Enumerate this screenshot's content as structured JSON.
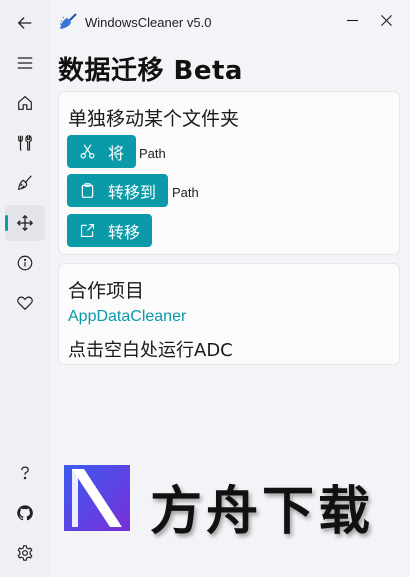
{
  "app": {
    "title": "WindowsCleaner v5.0"
  },
  "sidebar": {
    "items": [
      {
        "name": "back",
        "icon": "back-arrow-icon"
      },
      {
        "name": "menu",
        "icon": "hamburger-menu-icon"
      },
      {
        "name": "home",
        "icon": "home-icon"
      },
      {
        "name": "tools",
        "icon": "tools-icon"
      },
      {
        "name": "clean",
        "icon": "broom-icon"
      },
      {
        "name": "migrate",
        "icon": "move-arrows-icon",
        "active": true
      },
      {
        "name": "about",
        "icon": "info-icon"
      },
      {
        "name": "favorite",
        "icon": "heart-icon"
      },
      {
        "name": "help",
        "icon": "help-icon"
      },
      {
        "name": "github",
        "icon": "github-icon"
      },
      {
        "name": "settings",
        "icon": "gear-icon"
      }
    ]
  },
  "page": {
    "title": "数据迁移 Beta"
  },
  "move_card": {
    "title": "单独移动某个文件夹",
    "buttons": [
      {
        "label": "将",
        "icon": "cut-icon",
        "path": "Path"
      },
      {
        "label": "转移到",
        "icon": "clipboard-icon",
        "path": "Path"
      },
      {
        "label": "转移",
        "icon": "share-icon"
      }
    ]
  },
  "partner_card": {
    "title": "合作项目",
    "link": "AppDataCleaner",
    "text": "点击空白处运行ADC"
  },
  "watermark": {
    "text": "方舟下载"
  },
  "colors": {
    "accent": "#0a9aa8",
    "background": "#f3f4f7",
    "sidebar": "#eef0f4"
  }
}
